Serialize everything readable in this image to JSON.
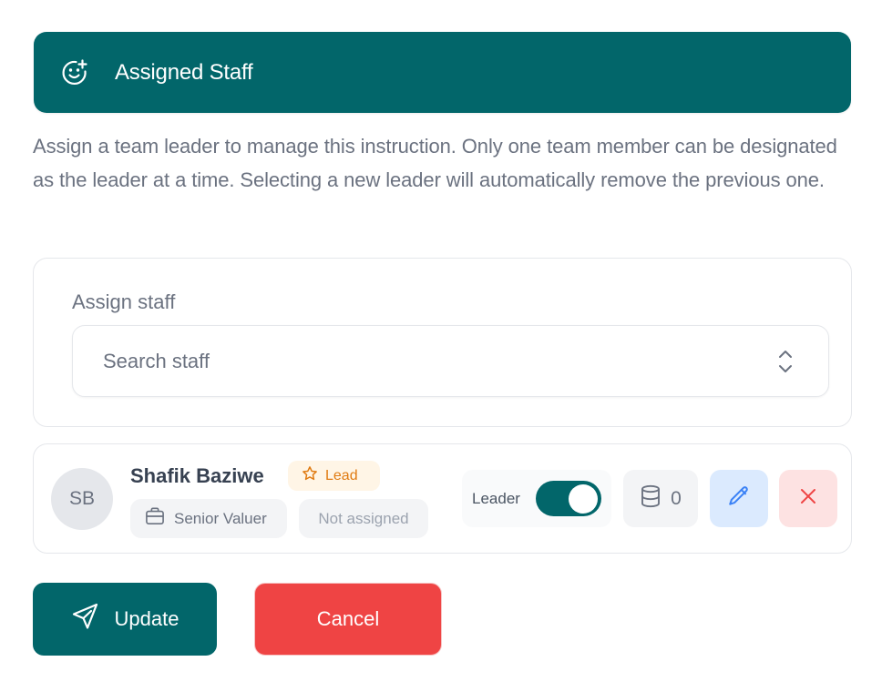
{
  "header": {
    "title": "Assigned Staff",
    "icon": "smile-plus-icon"
  },
  "description": "Assign a team leader to manage this instruction. Only one team member can be designated as the leader at a time. Selecting a new leader will automatically remove the previous one.",
  "assign": {
    "label": "Assign staff",
    "placeholder": "Search staff"
  },
  "staff": [
    {
      "initials": "SB",
      "name": "Shafik Baziwe",
      "badge": "Lead",
      "role": "Senior Valuer",
      "assignment": "Not assigned",
      "leader_label": "Leader",
      "leader_on": true,
      "count": "0"
    }
  ],
  "actions": {
    "update_label": "Update",
    "cancel_label": "Cancel"
  },
  "colors": {
    "primary": "#02666a",
    "danger": "#ef4444",
    "lead_badge_text": "#e07b12",
    "edit_icon": "#3b82f6"
  }
}
